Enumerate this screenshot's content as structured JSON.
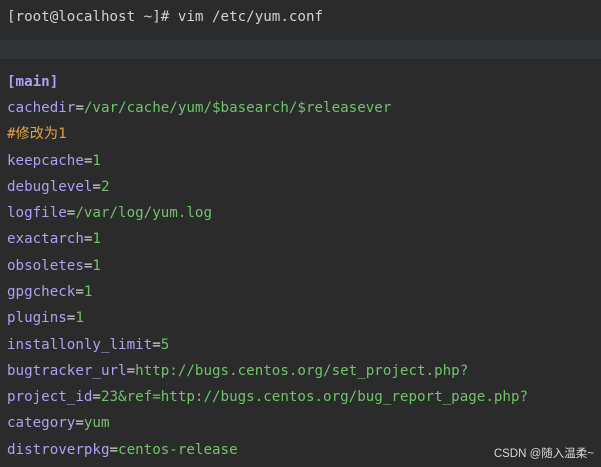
{
  "terminal": {
    "prompt": "[root@localhost ~]# vim /etc/yum.conf",
    "section_header": "[main]",
    "lines": [
      {
        "key": "cachedir",
        "eq": "=",
        "value": "/var/cache/yum/$basearch/$releasever"
      },
      {
        "comment": "#修改为1"
      },
      {
        "key": "keepcache",
        "eq": "=",
        "value": "1"
      },
      {
        "key": "debuglevel",
        "eq": "=",
        "value": "2"
      },
      {
        "key": "logfile",
        "eq": "=",
        "value": "/var/log/yum.log"
      },
      {
        "key": "exactarch",
        "eq": "=",
        "value": "1"
      },
      {
        "key": "obsoletes",
        "eq": "=",
        "value": "1"
      },
      {
        "key": "gpgcheck",
        "eq": "=",
        "value": "1"
      },
      {
        "key": "plugins",
        "eq": "=",
        "value": "1"
      },
      {
        "key": "installonly_limit",
        "eq": "=",
        "value": "5"
      },
      {
        "key": "bugtracker_url",
        "eq": "=",
        "value": "http://bugs.centos.org/set_project.php?"
      },
      {
        "key": "project_id",
        "eq": "=",
        "value": "23&ref=http://bugs.centos.org/bug_report_page.php?"
      },
      {
        "key": "category",
        "eq": "=",
        "value": "yum"
      },
      {
        "key": "distroverpkg",
        "eq": "=",
        "value": "centos-release"
      }
    ]
  },
  "watermark": "CSDN @随入温柔~",
  "colors": {
    "background": "#2b2b2b",
    "key": "#a9a3f5",
    "value": "#6fc46a",
    "comment": "#e0a24a",
    "text": "#cfd2d6"
  }
}
